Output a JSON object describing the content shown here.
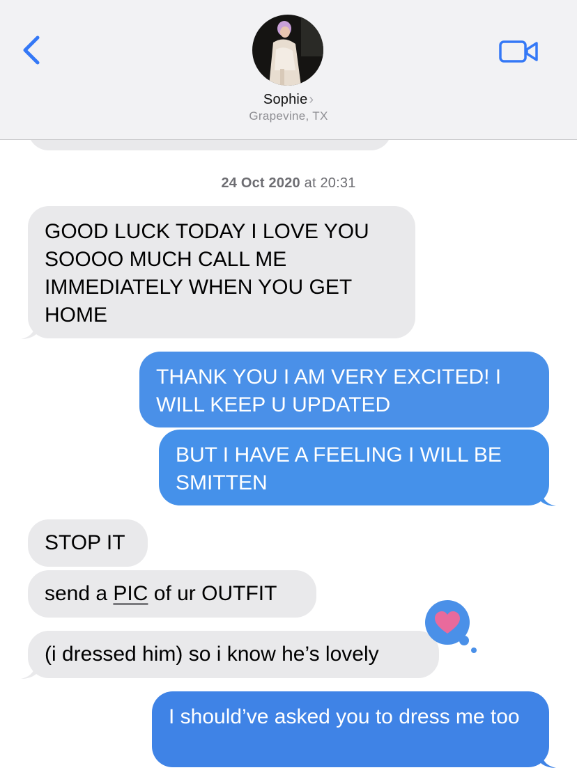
{
  "header": {
    "contact_name": "Sophie",
    "contact_chevron": "›",
    "location": "Grapevine, TX",
    "back_icon": "chevron-left-icon",
    "video_icon": "video-camera-icon",
    "accent": "#3478f6"
  },
  "conversation": {
    "timestamp_date": "24 Oct 2020",
    "timestamp_at": "at",
    "timestamp_time": "20:31",
    "messages": [
      {
        "from": "contact",
        "text": "GOOD LUCK TODAY I LOVE YOU SOOOO MUCH CALL ME IMMEDIATELY WHEN YOU GET HOME"
      },
      {
        "from": "me",
        "text": "THANK YOU I AM VERY EXCITED! I WILL KEEP U UPDATED"
      },
      {
        "from": "me",
        "text": "BUT I HAVE A FEELING I WILL BE SMITTEN"
      },
      {
        "from": "contact",
        "text": "STOP IT"
      },
      {
        "from": "contact",
        "text_before": "send a ",
        "text_link": "PIC",
        "text_after": " of ur OUTFIT"
      },
      {
        "from": "contact",
        "text": "(i dressed him) so i know he’s lovely",
        "reaction": "heart-icon"
      },
      {
        "from": "me",
        "text": "I should’ve asked you to dress me too"
      }
    ]
  },
  "colors": {
    "received_bubble": "#e9e9eb",
    "sent_bubble": "#4a90e8",
    "header_bg": "#f2f2f4",
    "heart": "#e96a9c"
  }
}
